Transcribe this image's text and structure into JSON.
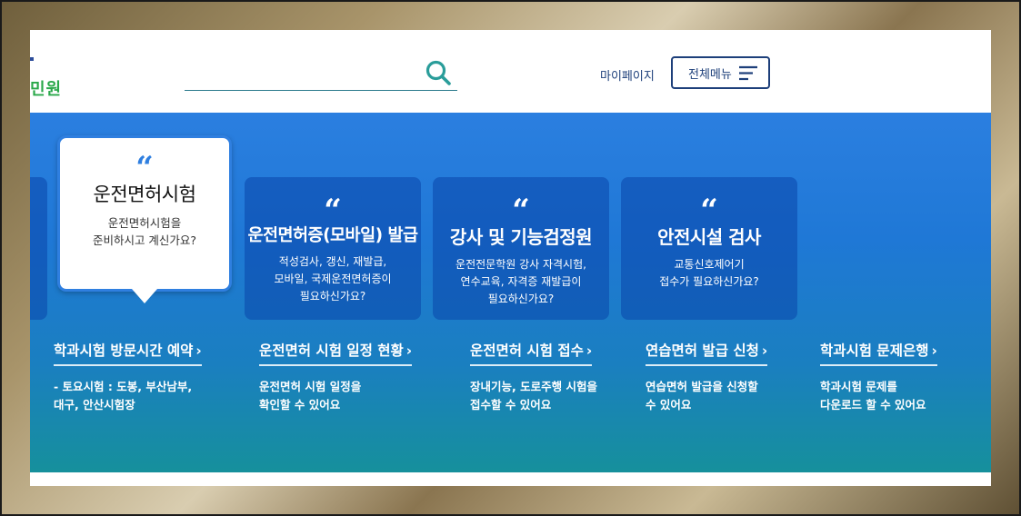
{
  "header": {
    "logo_text": "민원",
    "search": {
      "placeholder": "",
      "value": ""
    },
    "mypage_label": "마이페이지",
    "allmenu_label": "전체메뉴"
  },
  "cards": [
    {
      "title": "운전면허시험",
      "desc": "운전면허시험을\n준비하시고 계신가요?",
      "active": true
    },
    {
      "title": "운전면허증(모바일) 발급",
      "desc": "적성검사, 갱신, 재발급,\n모바일, 국제운전면허증이\n필요하신가요?"
    },
    {
      "title": "강사 및 기능검정원",
      "desc": "운전전문학원 강사 자격시험,\n연수교육, 자격증 재발급이\n필요하신가요?"
    },
    {
      "title": "안전시설 검사",
      "desc": "교통신호제어기\n접수가 필요하신가요?"
    }
  ],
  "quote_glyph": "“",
  "links": [
    {
      "title": "학과시험 방문시간 예약",
      "desc": "- 토요시험 : 도봉, 부산남부,\n   대구, 안산시험장"
    },
    {
      "title": "운전면허 시험 일정 현황",
      "desc": "운전면허 시험 일정을\n확인할 수 있어요"
    },
    {
      "title": "운전면허 시험 접수",
      "desc": "장내기능, 도로주행 시험을\n접수할 수 있어요"
    },
    {
      "title": "연습면허 발급 신청",
      "desc": "연습면허 발급을 신청할\n수 있어요"
    },
    {
      "title": "학과시험 문제은행",
      "desc": "학과시험 문제를\n다운로드 할 수 있어요"
    }
  ],
  "arrow_glyph": "›",
  "colors": {
    "accent": "#2f7fe0",
    "navy": "#1d3f7a",
    "logo_green": "#2aa84a"
  }
}
